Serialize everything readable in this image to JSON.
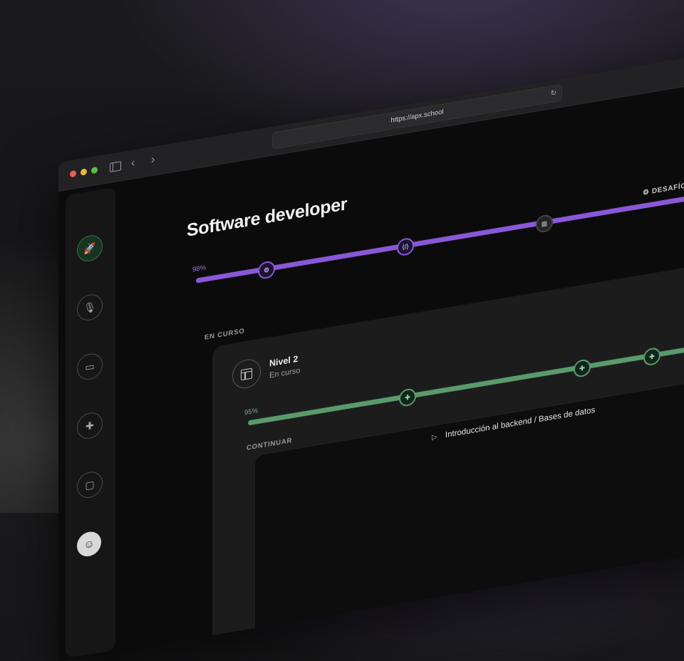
{
  "browser": {
    "url": "https://apx.school",
    "icons": {
      "sidebar": "sidebar-toggle-icon",
      "back": "chevron-left-icon",
      "forward": "chevron-right-icon",
      "reload": "reload-icon"
    },
    "glyphs": {
      "back": "‹",
      "forward": "›",
      "reload": "↻"
    }
  },
  "sidebar": {
    "items": [
      {
        "name": "rocket",
        "icon": "rocket-icon",
        "glyph": "🚀",
        "active": true
      },
      {
        "name": "microphone",
        "icon": "microphone-icon",
        "glyph": "🎙"
      },
      {
        "name": "book",
        "icon": "book-icon",
        "glyph": "▭"
      },
      {
        "name": "puzzle",
        "icon": "puzzle-icon",
        "glyph": "✚"
      },
      {
        "name": "chat",
        "icon": "chat-icon",
        "glyph": "▢"
      }
    ],
    "avatar_glyph": "☺"
  },
  "main": {
    "title": "Software developer",
    "progress": {
      "label": "98%",
      "value": 0.98,
      "color": "#8a57d8"
    },
    "nodes": [
      {
        "icon": "gear-icon",
        "glyph": "⚙"
      },
      {
        "icon": "code-icon",
        "glyph": "⟨/⟩"
      },
      {
        "icon": "layout-icon",
        "glyph": "▦"
      }
    ],
    "challenge_label": "DESAFÍO",
    "challenge_icon_glyph": "⚙",
    "in_progress_label": "EN CURSO",
    "continue_label": "CONTINUAR",
    "level_card": {
      "title": "Nivel 2",
      "status": "En curso",
      "progress": {
        "label": "95%",
        "value": 0.95,
        "color": "#5a9a6b"
      },
      "nodes": [
        {
          "icon": "puzzle-icon",
          "glyph": "✚"
        },
        {
          "icon": "puzzle-icon",
          "glyph": "✚"
        },
        {
          "icon": "puzzle-icon",
          "glyph": "✚"
        }
      ]
    },
    "continue_item": {
      "play_glyph": "▷",
      "text": "Introducción al backend / Bases de datos"
    }
  }
}
